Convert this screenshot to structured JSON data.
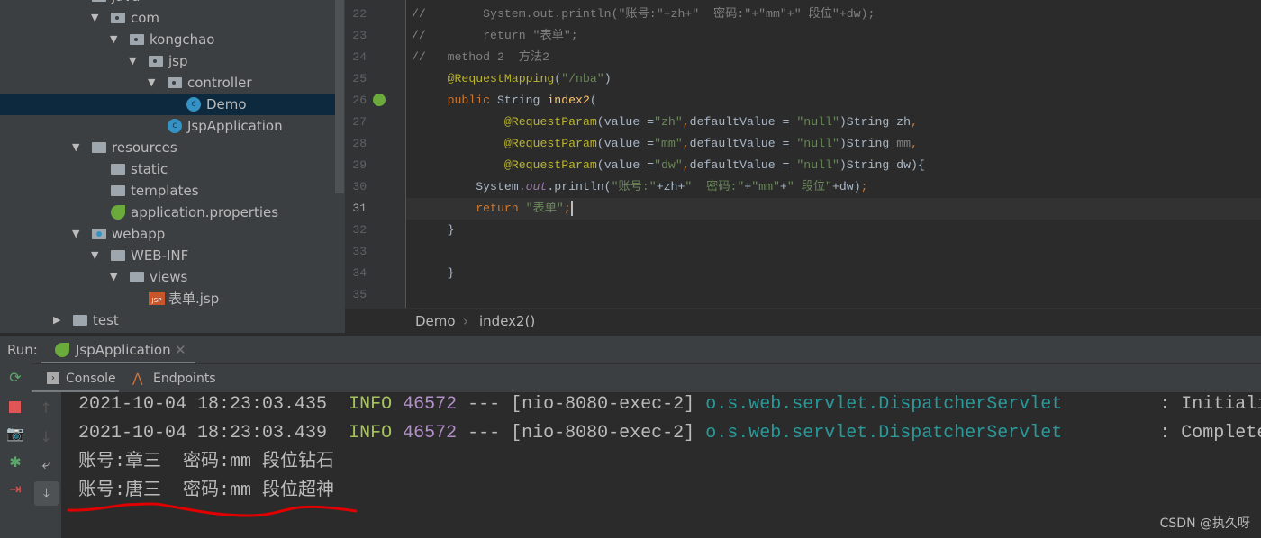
{
  "project_tree": [
    {
      "label": "java",
      "level": 2,
      "expanded": true,
      "icon": "source-folder-icon"
    },
    {
      "label": "com",
      "level": 3,
      "expanded": true,
      "icon": "package-icon"
    },
    {
      "label": "kongchao",
      "level": 4,
      "expanded": true,
      "icon": "package-icon"
    },
    {
      "label": "jsp",
      "level": 5,
      "expanded": true,
      "icon": "package-icon"
    },
    {
      "label": "controller",
      "level": 6,
      "expanded": true,
      "icon": "package-icon"
    },
    {
      "label": "Demo",
      "level": 7,
      "icon": "class-icon",
      "selected": true
    },
    {
      "label": "JspApplication",
      "level": 6,
      "icon": "spring-boot-class-icon"
    },
    {
      "label": "resources",
      "level": 2,
      "expanded": true,
      "icon": "resources-folder-icon"
    },
    {
      "label": "static",
      "level": 3,
      "icon": "folder-icon"
    },
    {
      "label": "templates",
      "level": 3,
      "icon": "folder-icon"
    },
    {
      "label": "application.properties",
      "level": 3,
      "icon": "spring-properties-icon"
    },
    {
      "label": "webapp",
      "level": 2,
      "expanded": true,
      "icon": "web-folder-icon"
    },
    {
      "label": "WEB-INF",
      "level": 3,
      "expanded": true,
      "icon": "folder-icon"
    },
    {
      "label": "views",
      "level": 4,
      "expanded": true,
      "icon": "folder-icon"
    },
    {
      "label": "表单.jsp",
      "level": 5,
      "icon": "jsp-file-icon"
    },
    {
      "label": "test",
      "level": 1,
      "expanded": false,
      "icon": "folder-icon"
    }
  ],
  "editor": {
    "current_line": 31,
    "lines": [
      {
        "n": "22",
        "seg": [
          [
            "com",
            "//        System.out.println(\"账号:\"+zh+\"  密码:\"+\"mm\"+\" 段位\"+dw);"
          ]
        ]
      },
      {
        "n": "23",
        "seg": [
          [
            "com",
            "//        return \"表单\";"
          ]
        ]
      },
      {
        "n": "24",
        "seg": [
          [
            "com",
            "//   method 2  方法2"
          ]
        ]
      },
      {
        "n": "25",
        "seg": [
          [
            "def",
            "     "
          ],
          [
            "ann",
            "@RequestMapping"
          ],
          [
            "def",
            "("
          ],
          [
            "str",
            "\"/nba\""
          ],
          [
            "def",
            ")"
          ]
        ]
      },
      {
        "n": "26",
        "seg": [
          [
            "def",
            "     "
          ],
          [
            "kw",
            "public "
          ],
          [
            "def",
            "String "
          ],
          [
            "fn",
            "index2"
          ],
          [
            "def",
            "("
          ]
        ]
      },
      {
        "n": "27",
        "seg": [
          [
            "def",
            "             "
          ],
          [
            "ann",
            "@RequestParam"
          ],
          [
            "def",
            "(value ="
          ],
          [
            "str",
            "\"zh\""
          ],
          [
            "kw",
            ","
          ],
          [
            "def",
            "defaultValue = "
          ],
          [
            "str",
            "\"null\""
          ],
          [
            "def",
            ")String zh"
          ],
          [
            "kw",
            ","
          ]
        ]
      },
      {
        "n": "28",
        "seg": [
          [
            "def",
            "             "
          ],
          [
            "ann",
            "@RequestParam"
          ],
          [
            "def",
            "(value ="
          ],
          [
            "str",
            "\"mm\""
          ],
          [
            "kw",
            ","
          ],
          [
            "def",
            "defaultValue = "
          ],
          [
            "str",
            "\"null\""
          ],
          [
            "def",
            ")String "
          ],
          [
            "com",
            "mm"
          ],
          [
            "kw",
            ","
          ]
        ]
      },
      {
        "n": "29",
        "seg": [
          [
            "def",
            "             "
          ],
          [
            "ann",
            "@RequestParam"
          ],
          [
            "def",
            "(value ="
          ],
          [
            "str",
            "\"dw\""
          ],
          [
            "kw",
            ","
          ],
          [
            "def",
            "defaultValue = "
          ],
          [
            "str",
            "\"null\""
          ],
          [
            "def",
            ")String dw){"
          ]
        ]
      },
      {
        "n": "30",
        "seg": [
          [
            "def",
            "         System."
          ],
          [
            "out",
            "out"
          ],
          [
            "def",
            ".println("
          ],
          [
            "str",
            "\"账号:\""
          ],
          [
            "def",
            "+zh+"
          ],
          [
            "str",
            "\"  密码:\""
          ],
          [
            "def",
            "+"
          ],
          [
            "str",
            "\"mm\""
          ],
          [
            "def",
            "+"
          ],
          [
            "str",
            "\" 段位\""
          ],
          [
            "def",
            "+dw)"
          ],
          [
            "kw",
            ";"
          ]
        ]
      },
      {
        "n": "31",
        "seg": [
          [
            "def",
            "         "
          ],
          [
            "kw",
            "return "
          ],
          [
            "str",
            "\"表单\""
          ],
          [
            "kw",
            ";"
          ]
        ]
      },
      {
        "n": "32",
        "seg": [
          [
            "def",
            "     }"
          ]
        ]
      },
      {
        "n": "33",
        "seg": []
      },
      {
        "n": "34",
        "seg": [
          [
            "def",
            "     }"
          ]
        ]
      },
      {
        "n": "35",
        "seg": []
      }
    ]
  },
  "breadcrumb": {
    "items": [
      "Demo",
      "index2()"
    ],
    "separator": "›"
  },
  "run": {
    "label": "Run:",
    "tab": "JspApplication",
    "tabs": [
      "Console",
      "Endpoints"
    ]
  },
  "console": {
    "log_lines": [
      {
        "time": "2021-10-04 18:23:03.435",
        "level": "INFO",
        "pid": "46572",
        "thread": "--- [nio-8080-exec-2]",
        "logger": "o.s.web.servlet.DispatcherServlet",
        "msg": "        : Initializ"
      },
      {
        "time": "2021-10-04 18:23:03.439",
        "level": "INFO",
        "pid": "46572",
        "thread": "--- [nio-8080-exec-2]",
        "logger": "o.s.web.servlet.DispatcherServlet",
        "msg": "        : Completed"
      }
    ],
    "output_lines": [
      "账号:章三  密码:mm 段位钻石",
      "账号:唐三  密码:mm 段位超神"
    ]
  },
  "annotation_color": "#e00000",
  "watermark": "CSDN @执久呀"
}
